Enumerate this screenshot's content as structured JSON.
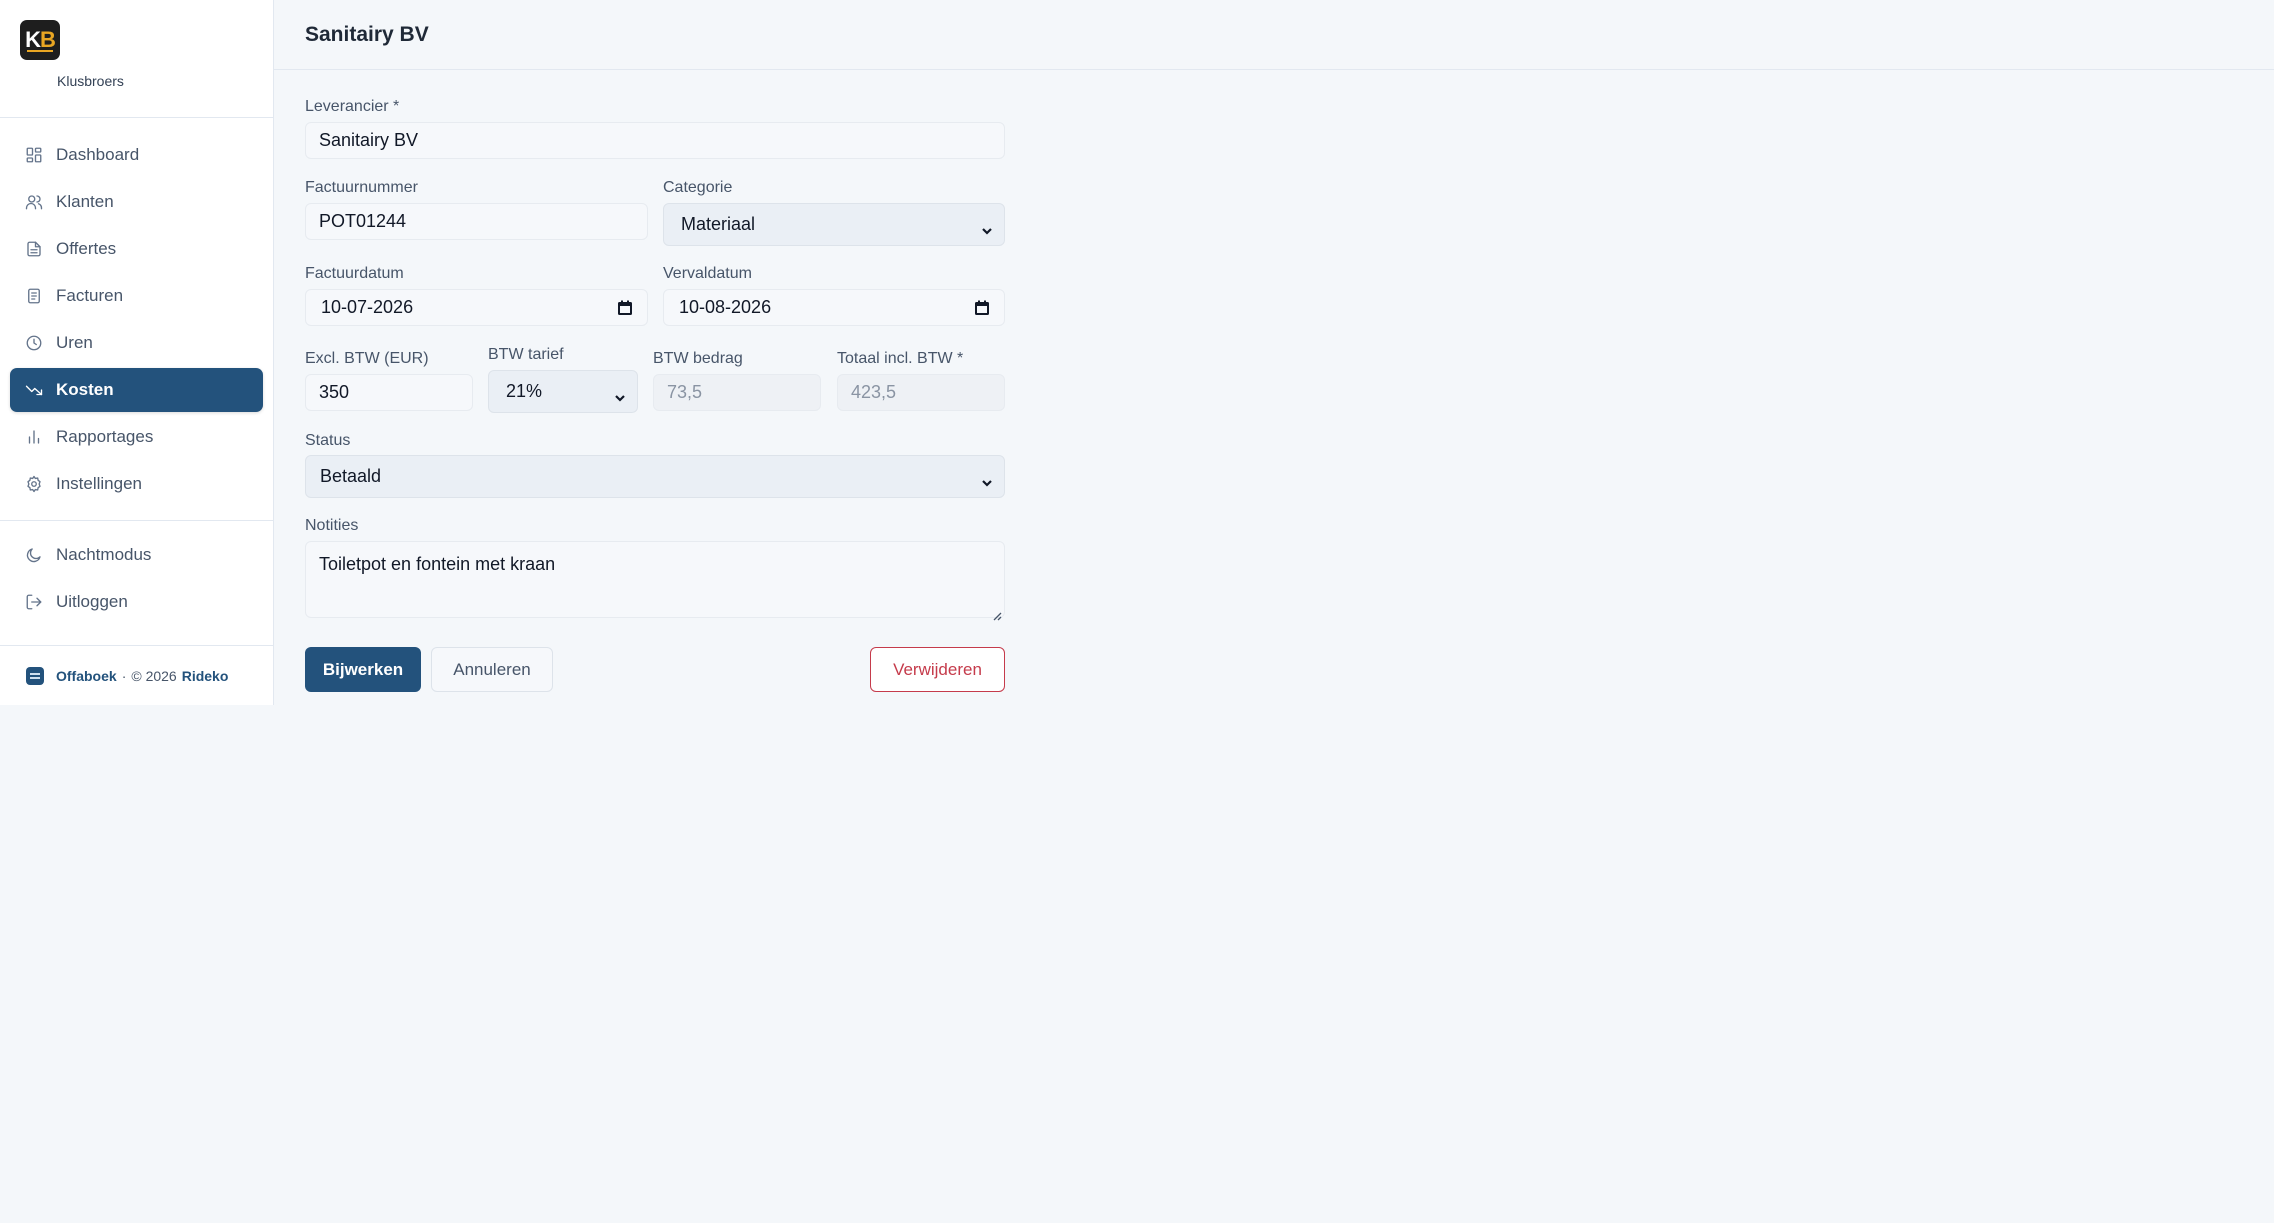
{
  "brand": {
    "logo_k": "K",
    "logo_b": "B",
    "name": "Klusbroers"
  },
  "nav": {
    "items": [
      {
        "label": "Dashboard",
        "icon": "grid-icon"
      },
      {
        "label": "Klanten",
        "icon": "users-icon"
      },
      {
        "label": "Offertes",
        "icon": "document-icon"
      },
      {
        "label": "Facturen",
        "icon": "receipt-icon"
      },
      {
        "label": "Uren",
        "icon": "clock-icon"
      },
      {
        "label": "Kosten",
        "icon": "trending-down-icon",
        "active": true
      },
      {
        "label": "Rapportages",
        "icon": "bar-chart-icon"
      },
      {
        "label": "Instellingen",
        "icon": "gear-icon"
      }
    ],
    "secondary": [
      {
        "label": "Nachtmodus",
        "icon": "moon-icon"
      },
      {
        "label": "Uitloggen",
        "icon": "logout-icon"
      }
    ]
  },
  "footer": {
    "product": "Offaboek",
    "separator": "·",
    "copyright": "© 2026",
    "company": "Rideko"
  },
  "header": {
    "title": "Sanitairy BV"
  },
  "form": {
    "supplier": {
      "label": "Leverancier *",
      "value": "Sanitairy BV"
    },
    "invoice_number": {
      "label": "Factuurnummer",
      "value": "POT01244"
    },
    "category": {
      "label": "Categorie",
      "value": "Materiaal"
    },
    "invoice_date": {
      "label": "Factuurdatum",
      "value": "10-07-2026"
    },
    "due_date": {
      "label": "Vervaldatum",
      "value": "10-08-2026"
    },
    "excl_vat": {
      "label": "Excl. BTW (EUR)",
      "value": "350"
    },
    "vat_rate": {
      "label": "BTW tarief",
      "value": "21%"
    },
    "vat_amount": {
      "label": "BTW bedrag",
      "value": "73,5"
    },
    "total": {
      "label": "Totaal incl. BTW *",
      "value": "423,5"
    },
    "status": {
      "label": "Status",
      "value": "Betaald"
    },
    "notes": {
      "label": "Notities",
      "value": "Toiletpot en fontein met kraan"
    }
  },
  "actions": {
    "update": "Bijwerken",
    "cancel": "Annuleren",
    "delete": "Verwijderen"
  },
  "colors": {
    "primary": "#23527c",
    "danger": "#c53b4b",
    "background": "#f4f7fa",
    "logo_accent": "#e9a623"
  }
}
